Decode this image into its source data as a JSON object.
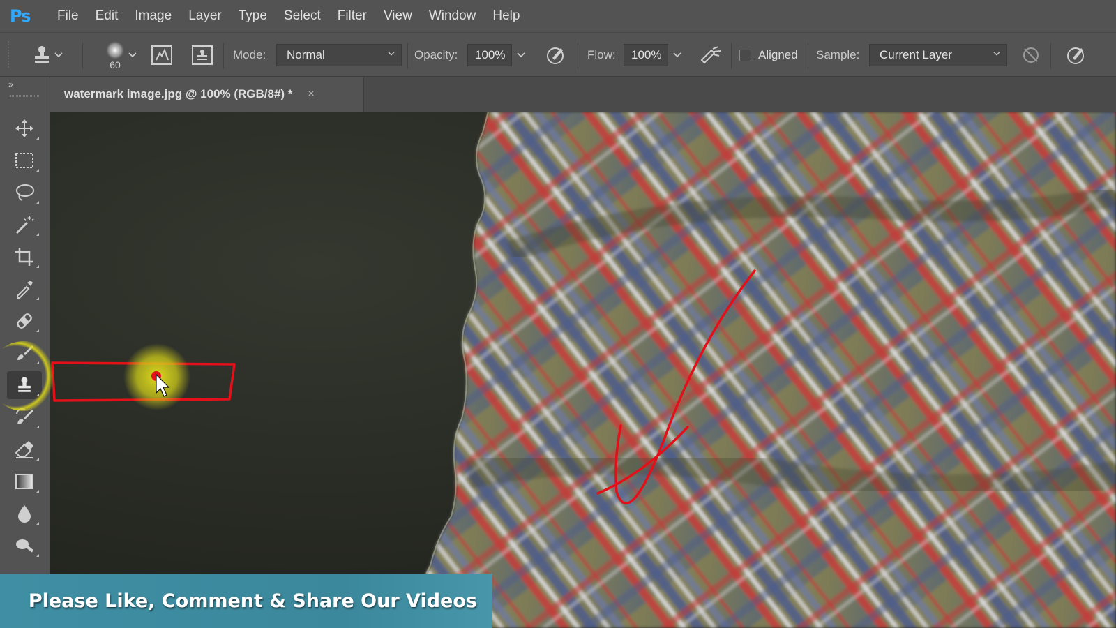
{
  "app": {
    "logo": "Ps"
  },
  "menu": [
    "File",
    "Edit",
    "Image",
    "Layer",
    "Type",
    "Select",
    "Filter",
    "View",
    "Window",
    "Help"
  ],
  "options_bar": {
    "brush_size": "60",
    "mode_label": "Mode:",
    "mode_value": "Normal",
    "opacity_label": "Opacity:",
    "opacity_value": "100%",
    "flow_label": "Flow:",
    "flow_value": "100%",
    "aligned_label": "Aligned",
    "aligned_checked": false,
    "sample_label": "Sample:",
    "sample_value": "Current Layer"
  },
  "toolbar": {
    "active_tool": "clone-stamp",
    "tools": [
      "move",
      "rectangular-marquee",
      "lasso",
      "magic-wand",
      "crop",
      "eyedropper",
      "healing-brush",
      "brush",
      "clone-stamp",
      "history-brush",
      "eraser",
      "gradient",
      "blur",
      "dodge"
    ]
  },
  "document": {
    "tab_title": "watermark image.jpg @ 100% (RGB/8#) *",
    "close_glyph": "×"
  },
  "annotation": {
    "color": "#e3101a",
    "highlight_color": "#d8d21a"
  },
  "banner": {
    "text": "Please Like, Comment & Share Our Videos"
  },
  "colors": {
    "ui_bg": "#535353",
    "ps_blue": "#31a8ff",
    "banner": "#3f8ea3"
  }
}
